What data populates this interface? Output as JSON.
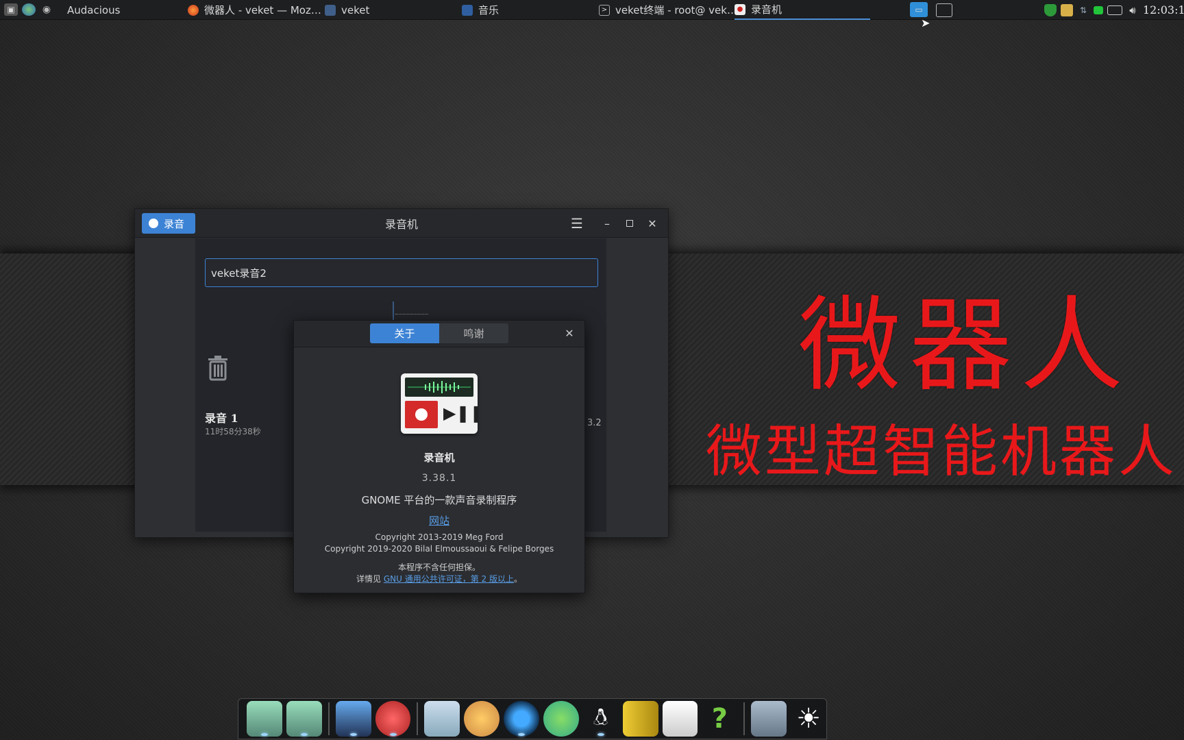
{
  "top_panel": {
    "launcher_app": "Audacious",
    "tasks": [
      {
        "title": "微器人 - veket — Moz…",
        "icon": "firefox-icon"
      },
      {
        "title": "veket",
        "icon": "folder-icon"
      },
      {
        "title": "音乐",
        "icon": "folder-music-icon"
      },
      {
        "title": "veket终端 - root@ vek…",
        "icon": "terminal-icon"
      },
      {
        "title": "录音机",
        "icon": "recorder-icon"
      }
    ],
    "clock": "12:03:1"
  },
  "wallpaper": {
    "big_text": "微器人",
    "small_text": "微型超智能机器人",
    "accent": "#e8181a"
  },
  "recorder": {
    "record_button": "录音",
    "title": "录音机",
    "name_value": "veket录音2",
    "recording": {
      "name": "录音 1",
      "duration": "11时58分38秒",
      "partial_value": "3.2"
    },
    "accent": "#3d83d5"
  },
  "about": {
    "tabs": [
      "关于",
      "鸣谢"
    ],
    "app_name": "录音机",
    "version": "3.38.1",
    "description": "GNOME 平台的一款声音录制程序",
    "website": "网站",
    "copyright1": "Copyright 2013-2019 Meg Ford",
    "copyright2": "Copyright 2019-2020 Bilal Elmoussaoui & Felipe Borges",
    "warranty": "本程序不含任何担保。",
    "license_prefix": "详情见 ",
    "license_link": "GNU 通用公共许可证，第 2 版以上",
    "license_suffix": "。"
  }
}
